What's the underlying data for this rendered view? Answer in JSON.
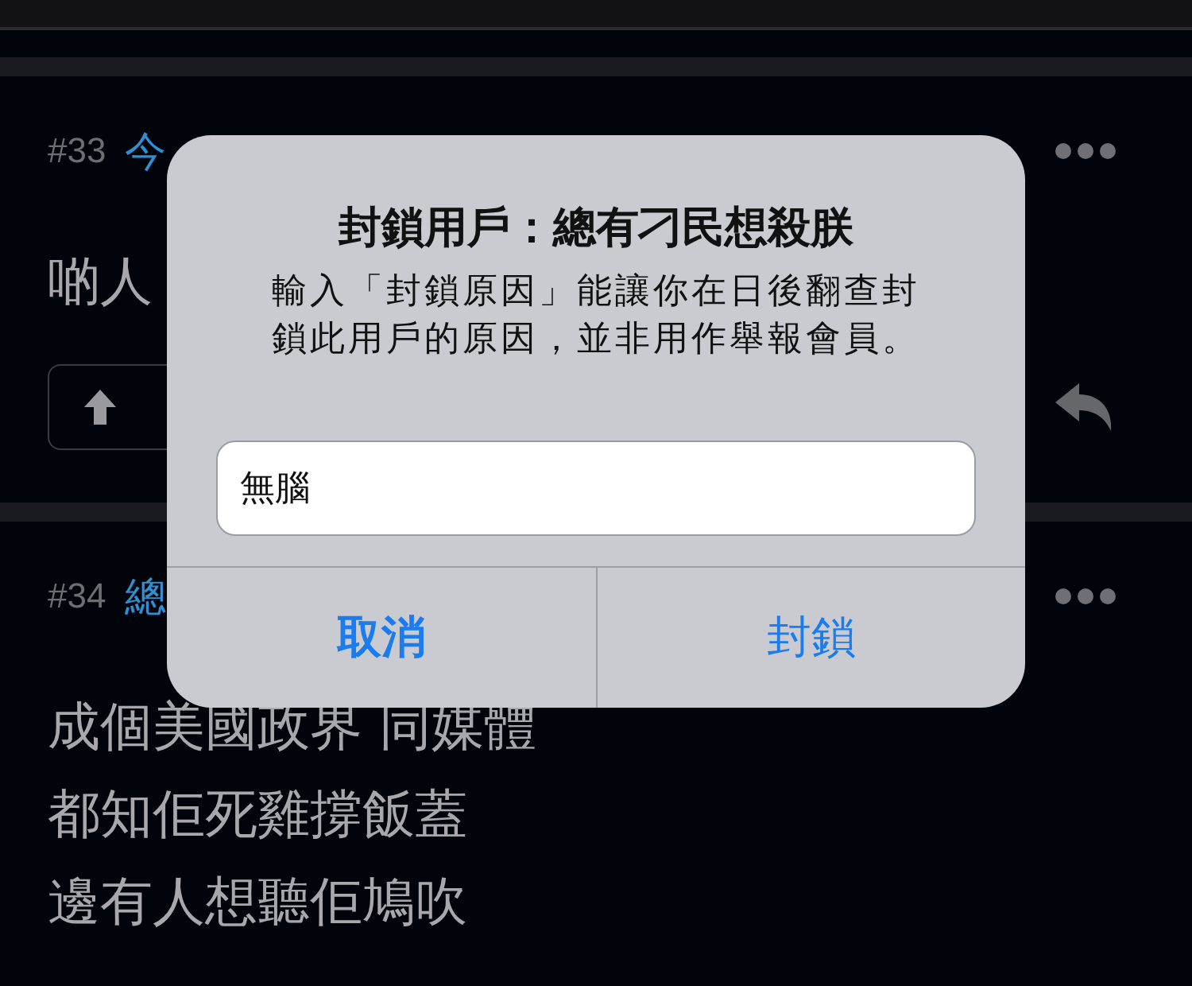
{
  "posts": [
    {
      "number": "#33",
      "author": "今",
      "body_lines": [
        "啲人"
      ],
      "has_actions": true
    },
    {
      "number": "#34",
      "author": "總",
      "body_lines": [
        "成個美國政界 同媒體",
        "都知佢死雞撐飯蓋",
        "邊有人想聽佢鳩吹"
      ],
      "has_actions": false
    }
  ],
  "dialog": {
    "title": "封鎖用戶：總有刁民想殺朕",
    "message": "輸入「封鎖原因」能讓你在日後翻查封鎖此用戶的原因，並非用作舉報會員。",
    "input": {
      "value": "無腦"
    },
    "buttons": [
      {
        "label": "取消",
        "kind": "cancel"
      },
      {
        "label": "封鎖",
        "kind": "confirm"
      }
    ]
  }
}
